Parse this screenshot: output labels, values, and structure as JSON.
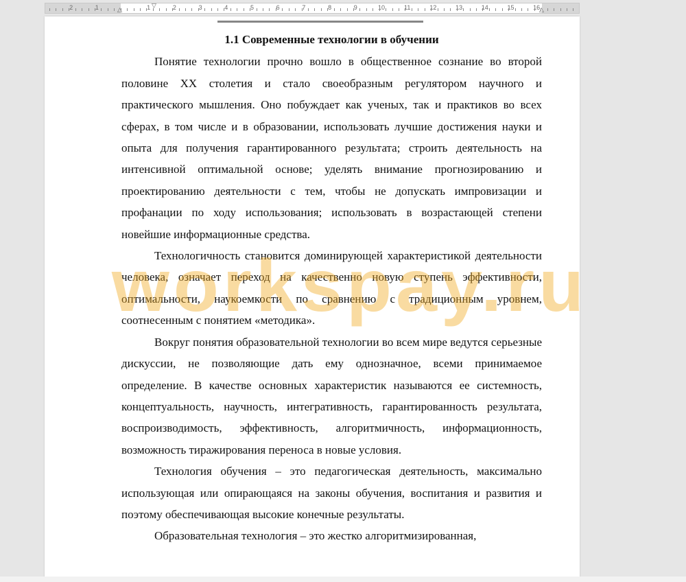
{
  "ruler": {
    "labels": [
      "2",
      "1",
      "1",
      "2",
      "3",
      "4",
      "5",
      "6",
      "7",
      "8",
      "9",
      "10",
      "11",
      "12",
      "13",
      "14",
      "15",
      "16",
      "17"
    ]
  },
  "document": {
    "heading": "1.1 Современные технологии в обучении",
    "paragraphs": [
      "Понятие технологии прочно вошло в общественное сознание во второй половине XX столетия и стало своеобразным регулятором научного и практического мышления. Оно побуждает как ученых, так и практиков во всех сферах, в том числе и в образовании, использовать лучшие достижения науки и опыта для получения гарантированного результата; строить деятельность на интенсивной оптимальной основе; уделять внимание прогнозированию и проектированию деятельности с тем, чтобы не допускать импровизации и профанации по ходу использования; использовать в возрастающей степени новейшие информационные средства.",
      "Технологичность становится доминирующей характеристикой деятельности человека, означает переход на качественно новую ступень эффективности, оптимальности, наукоемкости по сравнению с традиционным уровнем, соотнесенным с понятием «методика».",
      "Вокруг понятия образовательной технологии во всем мире ведутся серьезные дискуссии, не позволяющие дать ему однозначное, всеми принимаемое определение. В качестве основных характеристик называются ее системность, концептуальность, научность, интегративность, гарантированность результата, воспроизводимость, эффективность, алгоритмичность, информационность, возможность тиражирования переноса в новые условия.",
      "Технология обучения – это педагогическая деятельность, максимально использующая или опирающаяся на законы обучения, воспитания и развития и поэтому обеспечивающая высокие конечные результаты.",
      "Образовательная технология – это жестко алгоритмизированная,"
    ]
  },
  "watermark": {
    "text": "workspay.ru",
    "color": "#f0aa1e"
  }
}
